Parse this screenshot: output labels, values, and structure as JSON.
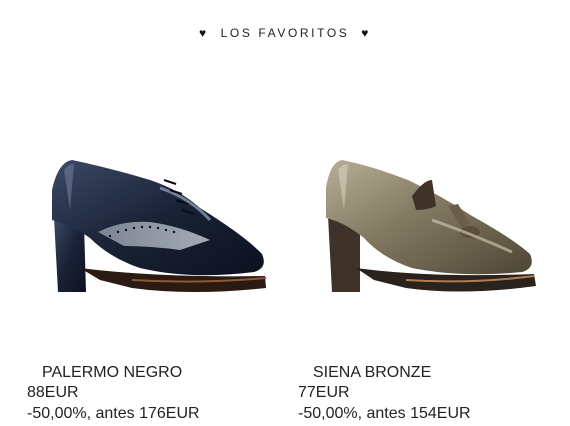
{
  "header": {
    "title": "LOS FAVORITOS",
    "left_icon": "heart-icon",
    "right_icon": "heart-icon"
  },
  "products": [
    {
      "name": "PALERMO NEGRO",
      "price": "88EUR",
      "discount": "-50,00%, antes 176EUR",
      "image": "navy-patent-brogue-heel-shoe"
    },
    {
      "name": "SIENA BRONZE",
      "price": "77EUR",
      "discount": "-50,00%, antes 154EUR",
      "image": "bronze-patent-tassel-loafer-heel"
    }
  ],
  "colors": {
    "text": "#222222",
    "muted": "#666666",
    "background": "#ffffff"
  }
}
